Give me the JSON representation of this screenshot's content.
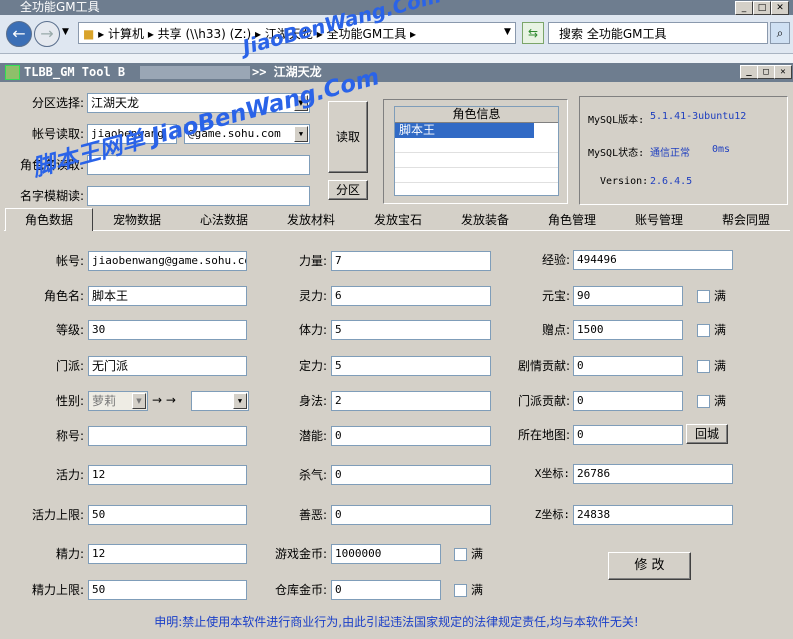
{
  "explorer": {
    "window_title": "全功能GM工具",
    "address": "▸ 计算机 ▸ 共享 (\\\\h33) (Z:) ▸ 江湖天龙 ▸ 全功能GM工具 ▸",
    "search_placeholder": "搜索 全功能GM工具"
  },
  "app": {
    "title_left": "TLBB_GM Tool B",
    "title_right": ">> 江湖天龙"
  },
  "watermark": {
    "line1": "JiaoBenWang.Com",
    "line2": "脚本王网单  JiaoBenWang.Com"
  },
  "top_form": {
    "zone_label": "分区选择:",
    "zone_value": "江湖天龙",
    "account_label": "帐号读取:",
    "account_value": "jiaobenwang",
    "domain_value": "@game.sohu.com",
    "rolename_label": "角色名读取:",
    "fuzzy_label": "名字模糊读:",
    "read_button": "读取",
    "zone_button": "分区"
  },
  "role_list": {
    "header": "角色信息",
    "items": [
      "脚本王"
    ]
  },
  "mysql": {
    "version_label": "MySQL版本:",
    "version_value": "5.1.41-3ubuntu12",
    "status_label": "MySQL状态:",
    "status_value": "通信正常",
    "status_ms": "0ms",
    "ver_label": "Version:",
    "ver_value": "2.6.4.5"
  },
  "tabs": [
    "角色数据",
    "宠物数据",
    "心法数据",
    "发放材料",
    "发放宝石",
    "发放装备",
    "角色管理",
    "账号管理",
    "帮会同盟"
  ],
  "fields": {
    "account": {
      "label": "帐号:",
      "value": "jiaobenwang@game.sohu.com"
    },
    "rolename": {
      "label": "角色名:",
      "value": "脚本王"
    },
    "level": {
      "label": "等级:",
      "value": "30"
    },
    "school": {
      "label": "门派:",
      "value": "无门派"
    },
    "gender": {
      "label": "性别:",
      "value": "萝莉",
      "arrow": "→ →"
    },
    "title": {
      "label": "称号:",
      "value": ""
    },
    "vigor": {
      "label": "活力:",
      "value": "12"
    },
    "vigor_max": {
      "label": "活力上限:",
      "value": "50"
    },
    "energy": {
      "label": "精力:",
      "value": "12"
    },
    "energy_max": {
      "label": "精力上限:",
      "value": "50"
    },
    "str": {
      "label": "力量:",
      "value": "7"
    },
    "spr": {
      "label": "灵力:",
      "value": "6"
    },
    "con": {
      "label": "体力:",
      "value": "5"
    },
    "ipr": {
      "label": "定力:",
      "value": "5"
    },
    "dex": {
      "label": "身法:",
      "value": "2"
    },
    "potential": {
      "label": "潜能:",
      "value": "0"
    },
    "killval": {
      "label": "杀气:",
      "value": "0"
    },
    "goodevil": {
      "label": "善恶:",
      "value": "0"
    },
    "gold": {
      "label": "游戏金币:",
      "value": "1000000",
      "check": "满"
    },
    "bank_gold": {
      "label": "仓库金币:",
      "value": "0",
      "check": "满"
    },
    "exp": {
      "label": "经验:",
      "value": "494496"
    },
    "yuanbao": {
      "label": "元宝:",
      "value": "90",
      "check": "满"
    },
    "zengdian": {
      "label": "赠点:",
      "value": "1500",
      "check": "满"
    },
    "plot": {
      "label": "剧情贡献:",
      "value": "0",
      "check": "满"
    },
    "school_contrib": {
      "label": "门派贡献:",
      "value": "0",
      "check": "满"
    },
    "map": {
      "label": "所在地图:",
      "value": "0",
      "button": "回城"
    },
    "xpos": {
      "label": "X坐标:",
      "value": "26786"
    },
    "zpos": {
      "label": "Z坐标:",
      "value": "24838"
    }
  },
  "modify_button": "修 改",
  "disclaimer": "申明:禁止使用本软件进行商业行为,由此引起违法国家规定的法律规定责任,均与本软件无关!"
}
